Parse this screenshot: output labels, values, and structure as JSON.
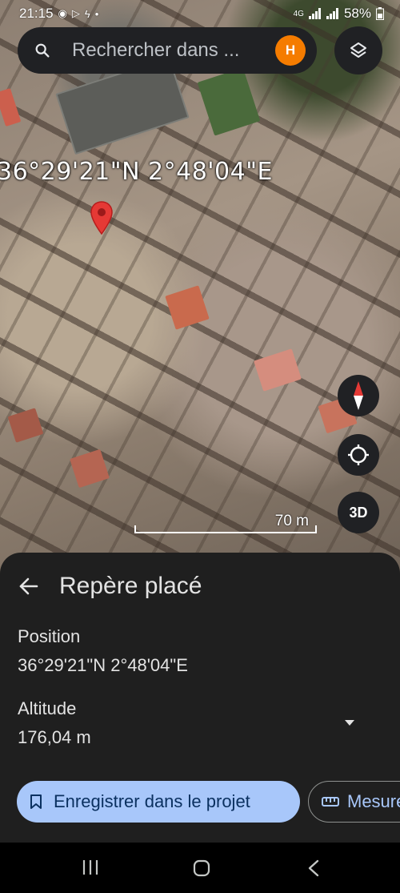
{
  "status_bar": {
    "time": "21:15",
    "notification_icons": [
      "whatsapp-icon",
      "play-store-icon",
      "messenger-icon",
      "dot-icon"
    ],
    "network": "4G",
    "battery": "58%"
  },
  "search": {
    "placeholder": "Rechercher dans ...",
    "avatar_letter": "H",
    "avatar_color": "#f57c00"
  },
  "map": {
    "coordinates_overlay": "36°29'21\"N 2°48'04\"E",
    "scale_label": "70 m",
    "pin_color": "#e53935",
    "threed_label": "3D"
  },
  "sheet": {
    "title": "Repère placé",
    "position_label": "Position",
    "position_value": "36°29'21\"N 2°48'04\"E",
    "altitude_label": "Altitude",
    "altitude_value": "176,04 m",
    "save_label": "Enregistrer dans le projet",
    "measure_label": "Mesurer"
  },
  "colors": {
    "sheet_bg": "#1f1f1f",
    "primary_button": "#a8c7fa",
    "primary_text": "#0b3160"
  }
}
